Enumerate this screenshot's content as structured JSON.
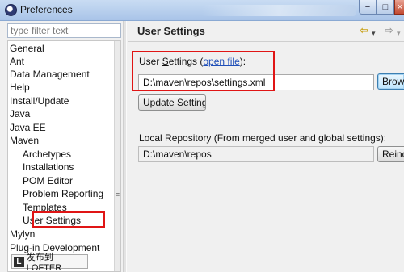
{
  "window": {
    "title": "Preferences",
    "minimize": "−",
    "maximize": "□",
    "close": "×"
  },
  "filter": {
    "placeholder": "type filter text"
  },
  "tree": {
    "items": [
      {
        "label": "General",
        "level": 0
      },
      {
        "label": "Ant",
        "level": 0
      },
      {
        "label": "Data Management",
        "level": 0
      },
      {
        "label": "Help",
        "level": 0
      },
      {
        "label": "Install/Update",
        "level": 0
      },
      {
        "label": "Java",
        "level": 0
      },
      {
        "label": "Java EE",
        "level": 0
      },
      {
        "label": "Maven",
        "level": 0
      },
      {
        "label": "Archetypes",
        "level": 1
      },
      {
        "label": "Installations",
        "level": 1
      },
      {
        "label": "POM Editor",
        "level": 1
      },
      {
        "label": "Problem Reporting",
        "level": 1
      },
      {
        "label": "Templates",
        "level": 1
      },
      {
        "label": "User Settings",
        "level": 1,
        "selected": true
      },
      {
        "label": "Mylyn",
        "level": 0
      },
      {
        "label": "Plug-in Development",
        "level": 0
      }
    ],
    "grip": "≡"
  },
  "watermark": {
    "logo": "L",
    "text": "发布到LOFTER"
  },
  "page": {
    "title": "User Settings",
    "nav_back": "⇦",
    "nav_back_dropdown": "▾",
    "nav_forward": "⇨",
    "nav_forward_dropdown": "▾"
  },
  "user_settings": {
    "label_prefix": "User ",
    "label_mnemonic": "S",
    "label_rest": "ettings (",
    "link": "open file",
    "label_suffix": "):",
    "value": "D:\\maven\\repos\\settings.xml",
    "browse_label": "Browse...",
    "update_label": "Update Settings"
  },
  "local_repo": {
    "label": "Local Repository (From merged user and global settings):",
    "value": "D:\\maven\\repos",
    "reindex_label": "Reindex"
  },
  "colors": {
    "annotation": "#e01515",
    "link": "#1f4fb8"
  }
}
